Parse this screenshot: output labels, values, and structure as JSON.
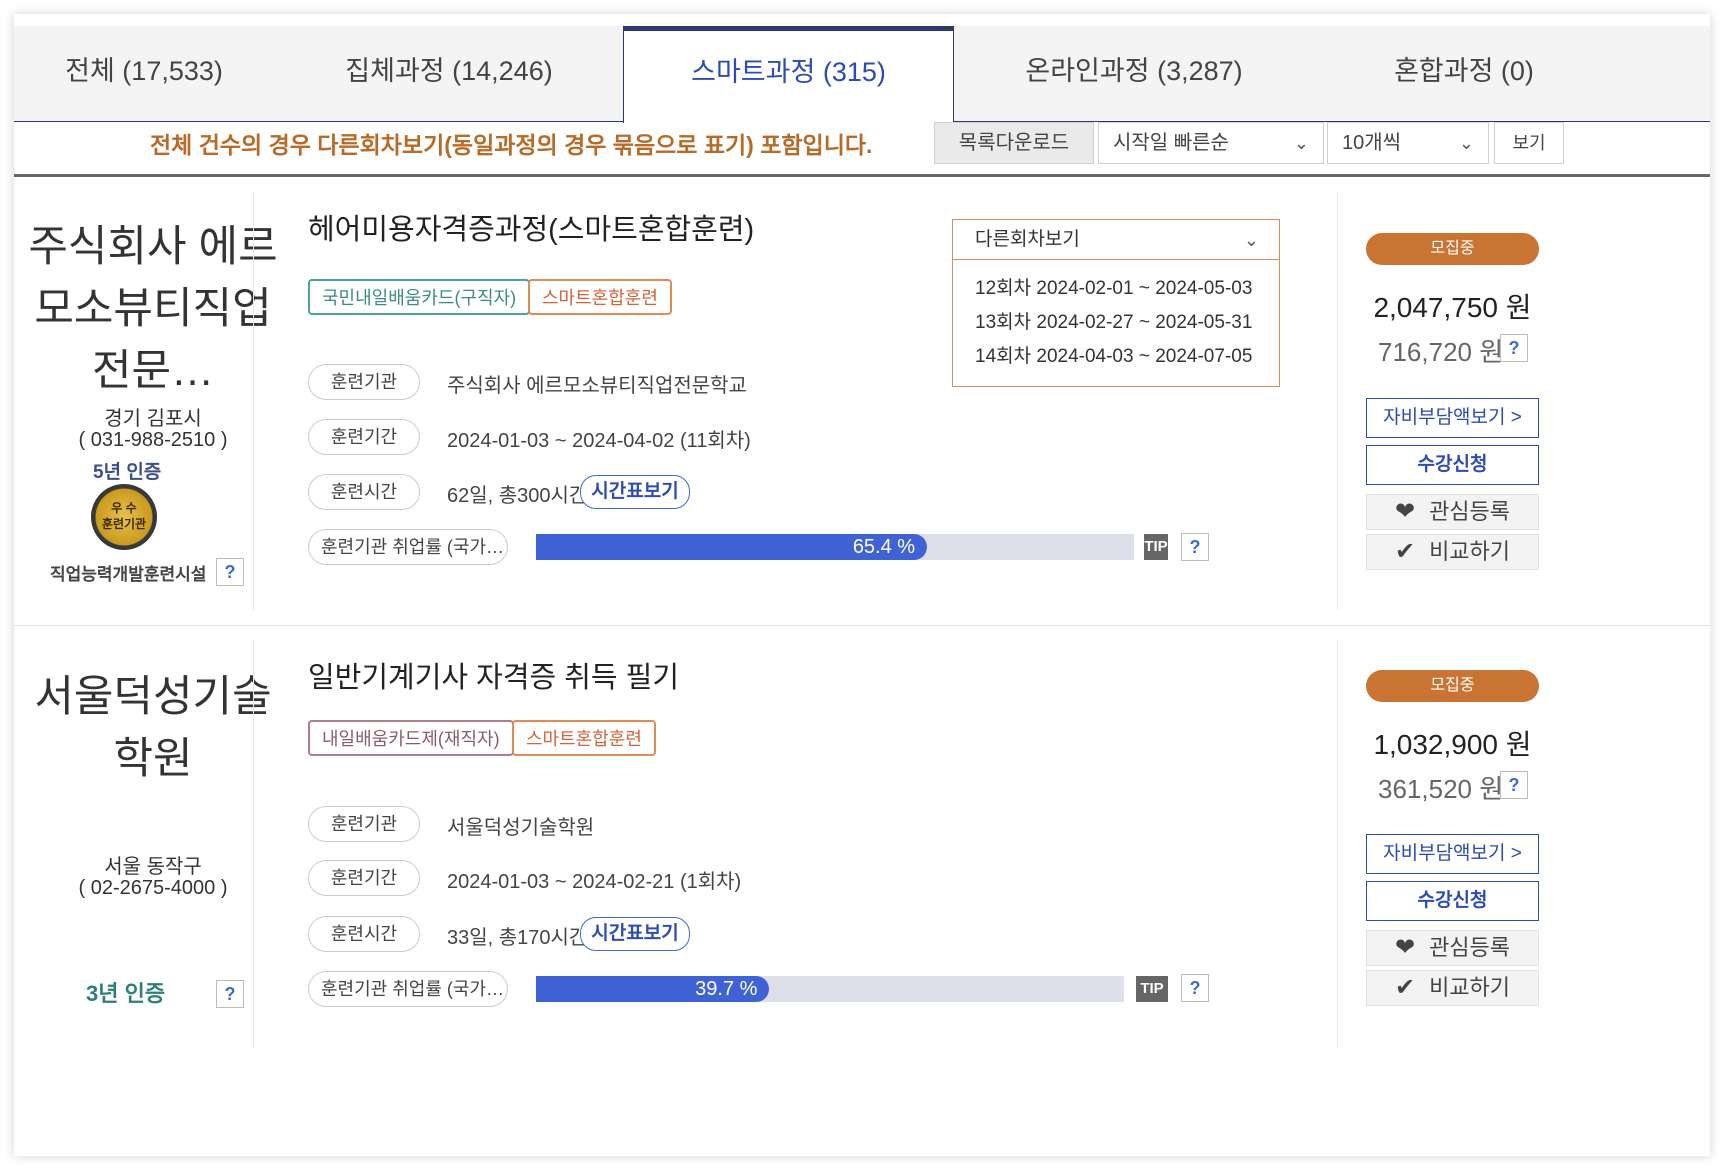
{
  "tabs": [
    {
      "label": "전체 (17,533)"
    },
    {
      "label": "집체과정 (14,246)"
    },
    {
      "label": "스마트과정 (315)"
    },
    {
      "label": "온라인과정 (3,287)"
    },
    {
      "label": "혼합과정 (0)"
    }
  ],
  "notice": "전체 건수의 경우 다른회차보기(동일과정의 경우 묶음으로 표기) 포함입니다.",
  "toolbar": {
    "download_label": "목록다운로드",
    "sort_value": "시작일 빠른순",
    "count_value": "10개씩",
    "view_label": "보기"
  },
  "courses": [
    {
      "institution": "주식회사 에르모소뷰티직업전문…",
      "location": "경기 김포시",
      "phone": "( 031-988-2510 )",
      "cert_label": "5년 인증",
      "badge_line1": "우 수",
      "badge_line2": "훈련기관",
      "facility_label": "직업능력개발훈련시설",
      "title": "헤어미용자격증과정(스마트혼합훈련)",
      "tags": [
        "국민내일배움카드(구직자)",
        "스마트혼합훈련"
      ],
      "label_institution": "훈련기관",
      "value_institution": "주식회사 에르모소뷰티직업전문학교",
      "label_period": "훈련기간",
      "value_period": "2024-01-03 ~ 2024-04-02 (11회차)",
      "label_hours": "훈련시간",
      "value_hours": "62일, 총300시간",
      "timetable_label": "시간표보기",
      "employment_label": "훈련기관 취업률 (국가…",
      "employment_rate": 65.4,
      "employment_text": "65.4 %",
      "tip_label": "TIP",
      "status": "모집중",
      "price": "2,047,750 원",
      "self_pay": "716,720 원",
      "self_pay_btn": "자비부담액보기 >",
      "apply_btn": "수강신청",
      "wish_btn": "관심등록",
      "compare_btn": "비교하기"
    },
    {
      "institution": "서울덕성기술학원",
      "location": "서울 동작구",
      "phone": "( 02-2675-4000 )",
      "cert_label": "3년 인증",
      "title": "일반기계기사 자격증 취득 필기",
      "tags": [
        "내일배움카드제(재직자)",
        "스마트혼합훈련"
      ],
      "label_institution": "훈련기관",
      "value_institution": "서울덕성기술학원",
      "label_period": "훈련기간",
      "value_period": "2024-01-03 ~ 2024-02-21 (1회차)",
      "label_hours": "훈련시간",
      "value_hours": "33일, 총170시간",
      "timetable_label": "시간표보기",
      "employment_label": "훈련기관 취업률 (국가…",
      "employment_rate": 39.7,
      "employment_text": "39.7 %",
      "tip_label": "TIP",
      "status": "모집중",
      "price": "1,032,900 원",
      "self_pay": "361,520 원",
      "self_pay_btn": "자비부담액보기 >",
      "apply_btn": "수강신청",
      "wish_btn": "관심등록",
      "compare_btn": "비교하기"
    }
  ],
  "rounds_dropdown": {
    "label": "다른회차보기",
    "items": [
      "12회차 2024-02-01 ~ 2024-05-03",
      "13회차 2024-02-27 ~ 2024-05-31",
      "14회차 2024-04-03 ~ 2024-07-05"
    ]
  },
  "help_mark": "?",
  "colors": {
    "accent_blue": "#2c4bb5",
    "bar_blue": "#3f63d4",
    "status_orange": "#c97432",
    "notice_orange": "#b86a26"
  }
}
